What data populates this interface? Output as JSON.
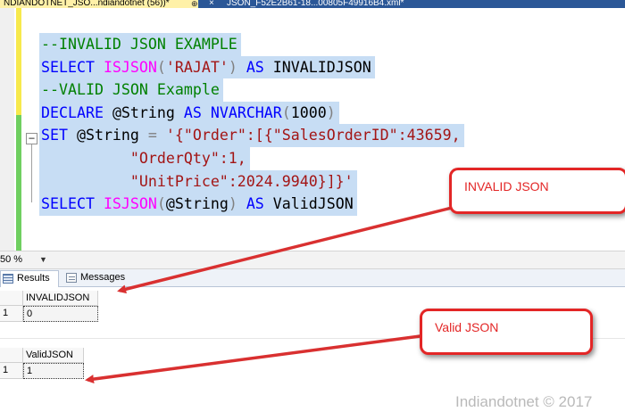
{
  "tabs": {
    "active_label": "NDIANDOTNET_JSO...ndiandotnet (56))*",
    "second_label": "JSON_F52E2B61-18...00805F49916B4.xml*",
    "close_glyph": "×",
    "pin_glyph": "⊕"
  },
  "editor": {
    "fold_glyph": "−",
    "lines": [
      {
        "parts": [
          {
            "t": "--INVALID JSON EXAMPLE",
            "c": "cm"
          }
        ]
      },
      {
        "parts": [
          {
            "t": "SELECT ",
            "c": "kw"
          },
          {
            "t": "ISJSON",
            "c": "fn"
          },
          {
            "t": "(",
            "c": "gy"
          },
          {
            "t": "'RAJAT'",
            "c": "st"
          },
          {
            "t": ") ",
            "c": "gy"
          },
          {
            "t": "AS ",
            "c": "kw"
          },
          {
            "t": "INVALIDJSON",
            "c": "tx"
          }
        ]
      },
      {
        "parts": [
          {
            "t": "--VALID JSON Example",
            "c": "cm"
          }
        ]
      },
      {
        "parts": [
          {
            "t": "DECLARE ",
            "c": "kw"
          },
          {
            "t": "@String ",
            "c": "tx"
          },
          {
            "t": "AS ",
            "c": "kw"
          },
          {
            "t": "NVARCHAR",
            "c": "kw"
          },
          {
            "t": "(",
            "c": "gy"
          },
          {
            "t": "1000",
            "c": "tx"
          },
          {
            "t": ")",
            "c": "gy"
          }
        ]
      },
      {
        "parts": [
          {
            "t": "SET ",
            "c": "kw"
          },
          {
            "t": "@String ",
            "c": "tx"
          },
          {
            "t": "= ",
            "c": "gy"
          },
          {
            "t": "'{\"Order\":[{\"SalesOrderID\":43659,",
            "c": "st"
          }
        ]
      },
      {
        "parts": [
          {
            "t": "          \"OrderQty\":1,",
            "c": "st"
          }
        ]
      },
      {
        "parts": [
          {
            "t": "          \"UnitPrice\":2024.9940}]}'",
            "c": "st"
          }
        ]
      },
      {
        "parts": [
          {
            "t": "SELECT ",
            "c": "kw"
          },
          {
            "t": "ISJSON",
            "c": "fn"
          },
          {
            "t": "(",
            "c": "gy"
          },
          {
            "t": "@String",
            "c": "tx"
          },
          {
            "t": ") ",
            "c": "gy"
          },
          {
            "t": "AS ",
            "c": "kw"
          },
          {
            "t": "ValidJSON",
            "c": "tx"
          }
        ]
      }
    ]
  },
  "zoom": {
    "level": "50 %",
    "arrow_glyph": "▼"
  },
  "result_tabs": {
    "results_label": "Results",
    "messages_label": "Messages"
  },
  "grid1": {
    "column": "INVALIDJSON",
    "row_number": "1",
    "value": "0"
  },
  "grid2": {
    "column": "ValidJSON",
    "row_number": "1",
    "value": "1"
  },
  "callouts": {
    "invalid_label": "INVALID JSON",
    "valid_label": "Valid JSON"
  },
  "colors": {
    "callout_red": "#e32626",
    "selection_blue": "#c7ddf4",
    "keyword_blue": "#0000ff",
    "comment_green": "#008000",
    "string_red": "#a31515",
    "function_magenta": "#ff00ff"
  },
  "watermark": "Indiandotnet © 2017"
}
